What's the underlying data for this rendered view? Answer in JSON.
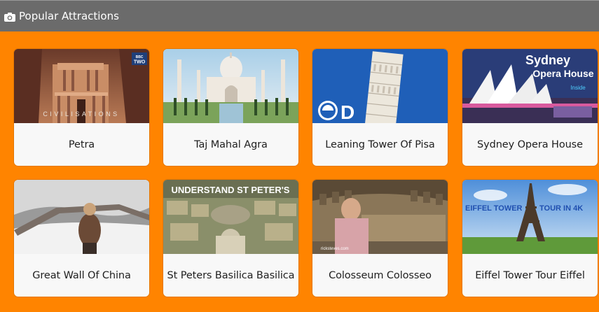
{
  "header": {
    "title": "Popular Attractions",
    "icon": "camera-icon"
  },
  "colors": {
    "background": "#ff8400",
    "header": "#6b6b6b",
    "card": "#f8f8f8"
  },
  "cards": [
    {
      "label": "Petra",
      "overlay": "CIVILISATIONS",
      "badge": "BBC TWO"
    },
    {
      "label": "Taj Mahal Agra"
    },
    {
      "label": "Leaning Tower Of Pisa",
      "badge": "discovery-logo"
    },
    {
      "label": "Sydney Opera House",
      "overlay_line1": "Sydney",
      "overlay_line2": "Opera House",
      "overlay_line3": "Inside"
    },
    {
      "label": "Great Wall Of China"
    },
    {
      "label": "St Peters Basilica Basilica",
      "overlay": "UNDERSTAND ST PETER'S"
    },
    {
      "label": "Colosseum Colosseo",
      "overlay": "ricksteves.com"
    },
    {
      "label": "Eiffel Tower Tour Eiffel",
      "overlay_left": "EIFFEL TOWER",
      "overlay_right": "TOUR IN 4K"
    }
  ]
}
